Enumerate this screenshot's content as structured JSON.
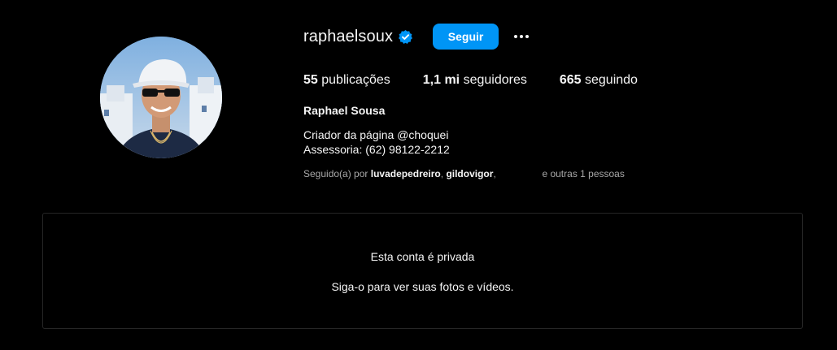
{
  "profile": {
    "username": "raphaelsoux",
    "follow_label": "Seguir",
    "full_name": "Raphael Sousa",
    "bio_lines": [
      "Criador da página @choquei",
      "Assessoria: (62) 98122-2212"
    ],
    "stats": {
      "posts_value": "55",
      "posts_label": "publicações",
      "followers_value": "1,1 mi",
      "followers_label": "seguidores",
      "following_value": "665",
      "following_label": "seguindo"
    },
    "followed_by": {
      "prefix": "Seguido(a) por",
      "accounts": [
        "luvadepedreiro",
        "gildovigor"
      ],
      "suffix": "e outras 1 pessoas"
    }
  },
  "private": {
    "title": "Esta conta é privada",
    "subtitle": "Siga-o para ver suas fotos e vídeos."
  },
  "colors": {
    "background": "#000000",
    "accent": "#0095f6",
    "text": "#f5f5f5",
    "muted": "#a8a8a8",
    "border": "#262626"
  },
  "icons": {
    "verified": "verified-badge-icon",
    "more": "more-options-icon"
  }
}
